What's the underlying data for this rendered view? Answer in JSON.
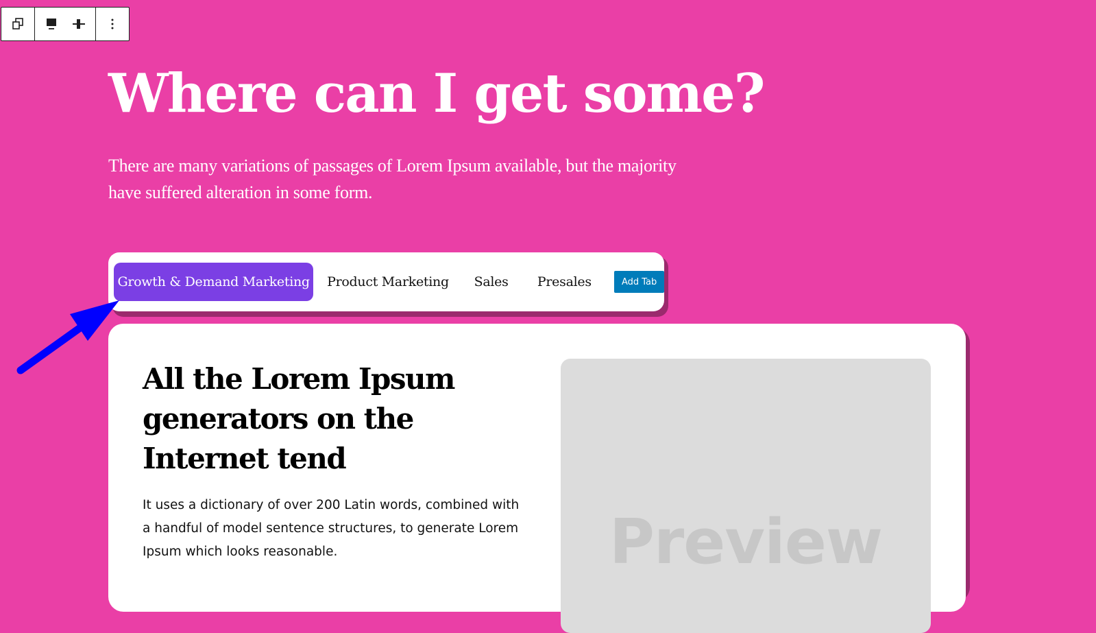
{
  "toolbar": {
    "groups": [
      {
        "name": "transform",
        "icons": [
          "duplicate-icon"
        ]
      },
      {
        "name": "layout",
        "icons": [
          "align-top-icon",
          "align-center-icon"
        ]
      },
      {
        "name": "more",
        "icons": [
          "more-vertical-icon"
        ]
      }
    ]
  },
  "hero": {
    "title": "Where can I get some?",
    "subtitle": "There are many variations of passages of Lorem Ipsum available, but the majority have suffered alteration in some form."
  },
  "tabs": {
    "items": [
      {
        "label": "Growth & Demand Marketing",
        "active": true
      },
      {
        "label": "Product Marketing",
        "active": false
      },
      {
        "label": "Sales",
        "active": false
      },
      {
        "label": "Presales",
        "active": false
      }
    ],
    "add_label": "Add Tab"
  },
  "panel": {
    "title": "All the Lorem Ipsum generators on the Internet tend",
    "text": "It uses a dictionary of over 200 Latin words, combined with a handful of model sentence structures, to generate Lorem Ipsum which looks reasonable.",
    "preview_label": "Preview"
  },
  "colors": {
    "background": "#ea3fa6",
    "active_tab": "#7b3fe4",
    "add_tab": "#007cba",
    "annotation_arrow": "#0000ff"
  }
}
